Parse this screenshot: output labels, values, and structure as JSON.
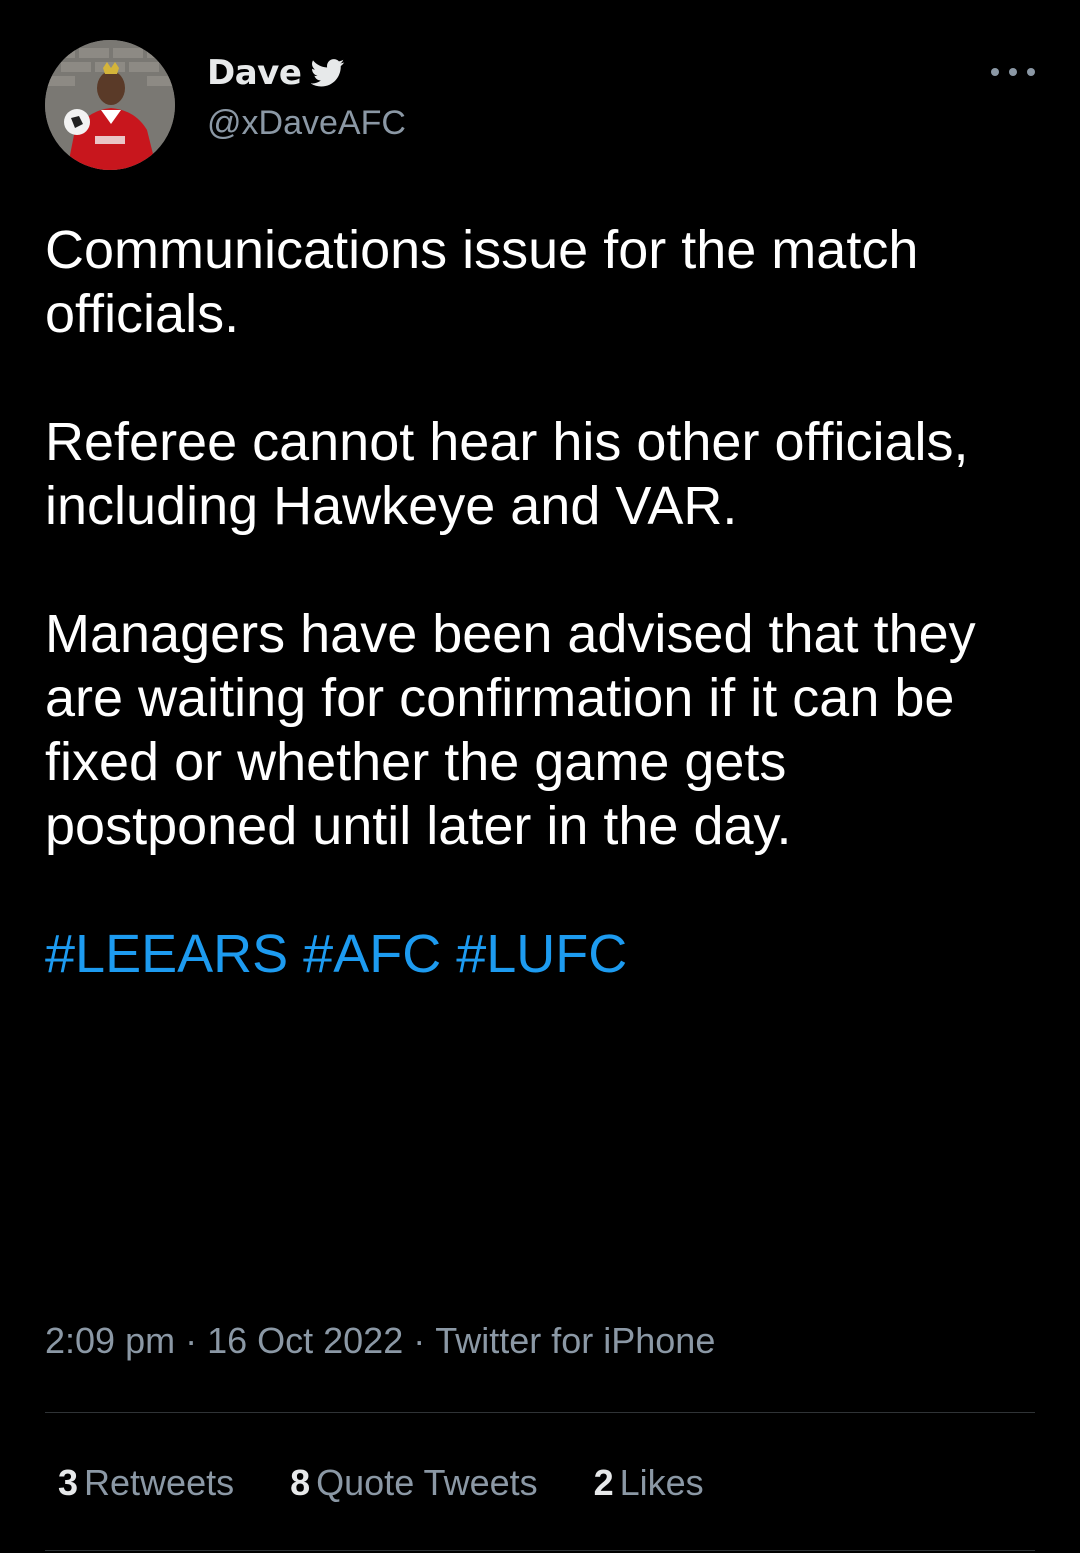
{
  "author": {
    "display_name": "Dave",
    "handle": "@xDaveAFC",
    "verified_icon": "twitter-bird-icon",
    "avatar": "profile-avatar-arsenal-player"
  },
  "tweet": {
    "paragraphs": [
      "Communications issue for the match officials.",
      "Referee cannot hear his other officials, including Hawkeye and VAR.",
      "Managers have been advised that they are waiting for confirmation if it can be fixed or whether the game gets postponed until later in the day."
    ],
    "hashtags": [
      "#LEEARS",
      "#AFC",
      "#LUFC"
    ]
  },
  "meta": {
    "time": "2:09 pm",
    "date": "16 Oct 2022",
    "source": "Twitter for iPhone",
    "separator": "·"
  },
  "stats": {
    "retweets_count": "3",
    "retweets_label": "Retweets",
    "quotes_count": "8",
    "quotes_label": "Quote Tweets",
    "likes_count": "2",
    "likes_label": "Likes"
  },
  "colors": {
    "background": "#000000",
    "text": "#ffffff",
    "secondary": "#8b98a5",
    "link": "#1d9bf0",
    "divider": "#2f3336"
  }
}
